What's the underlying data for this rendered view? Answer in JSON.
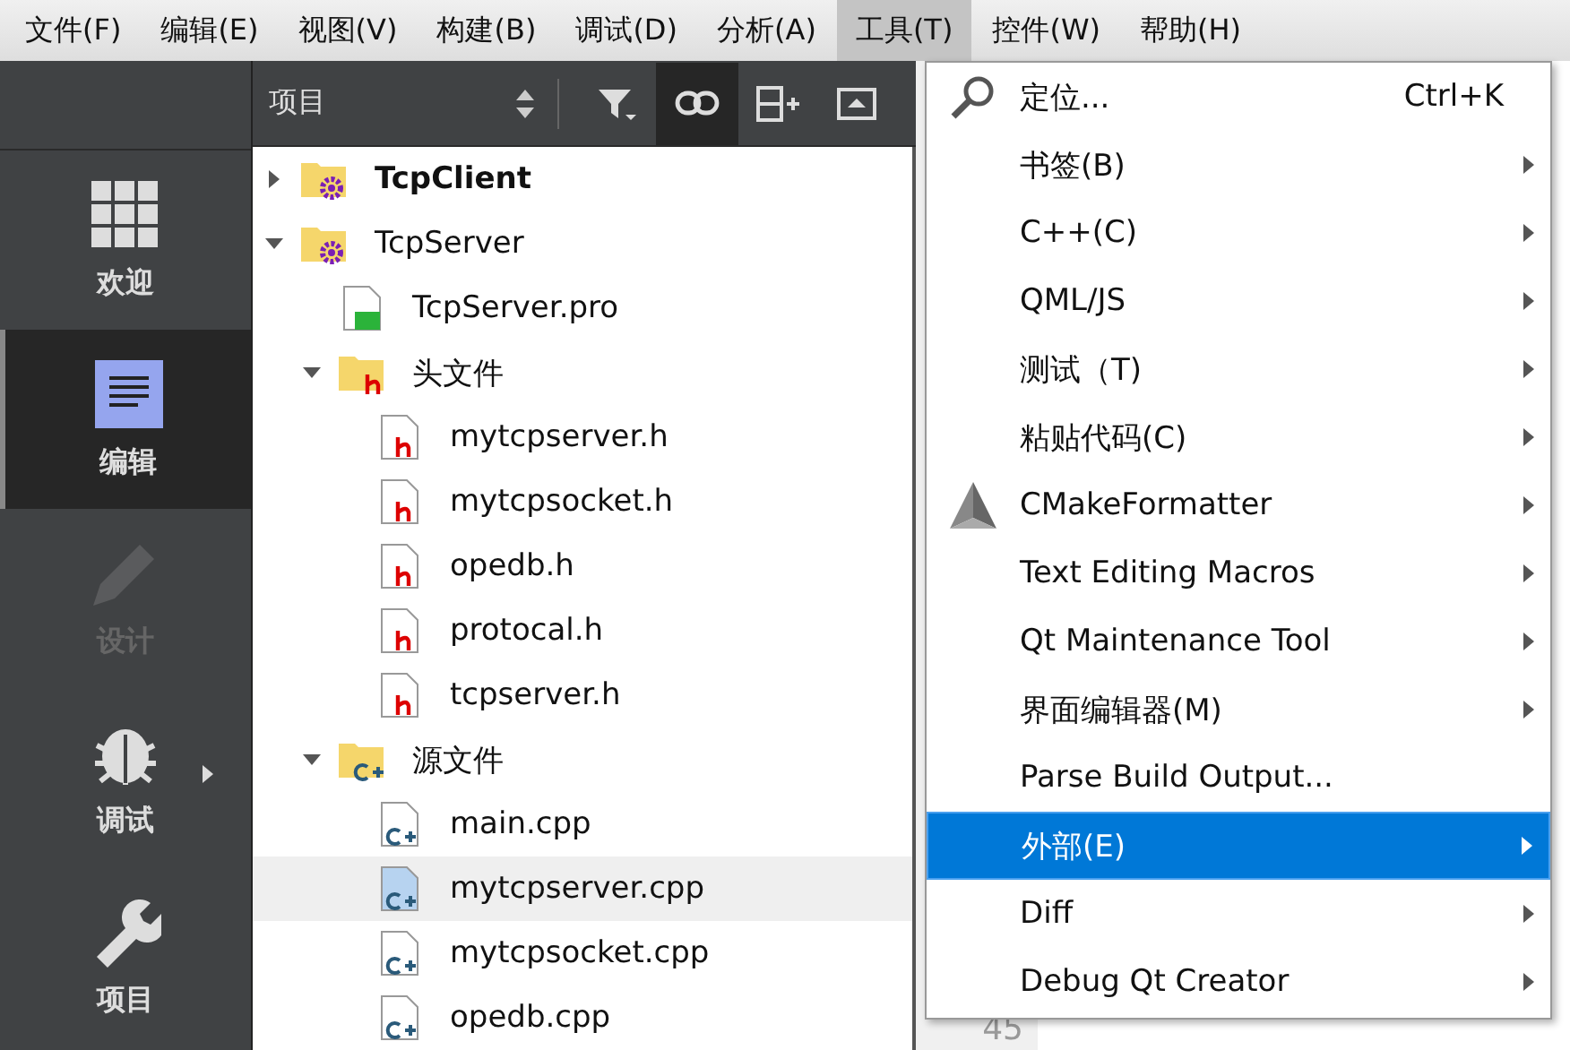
{
  "menubar": [
    {
      "label": "文件(F)",
      "selected": false
    },
    {
      "label": "编辑(E)",
      "selected": false
    },
    {
      "label": "视图(V)",
      "selected": false
    },
    {
      "label": "构建(B)",
      "selected": false
    },
    {
      "label": "调试(D)",
      "selected": false
    },
    {
      "label": "分析(A)",
      "selected": false
    },
    {
      "label": "工具(T)",
      "selected": true
    },
    {
      "label": "控件(W)",
      "selected": false
    },
    {
      "label": "帮助(H)",
      "selected": false
    }
  ],
  "modes": [
    {
      "label": "欢迎",
      "kind": "welcome",
      "selected": false,
      "disabled": false,
      "submenu": false
    },
    {
      "label": "编辑",
      "kind": "edit",
      "selected": true,
      "disabled": false,
      "submenu": false
    },
    {
      "label": "设计",
      "kind": "design",
      "selected": false,
      "disabled": true,
      "submenu": false
    },
    {
      "label": "调试",
      "kind": "debug",
      "selected": false,
      "disabled": false,
      "submenu": true
    },
    {
      "label": "项目",
      "kind": "projects",
      "selected": false,
      "disabled": false,
      "submenu": false
    }
  ],
  "panel": {
    "view": "项目",
    "link_pressed": true
  },
  "tree": [
    {
      "label": "TcpClient",
      "kind": "project",
      "active": true,
      "expanded": false,
      "selected": false
    },
    {
      "label": "TcpServer",
      "kind": "project",
      "active": false,
      "expanded": true,
      "selected": false,
      "children": [
        {
          "label": "TcpServer.pro",
          "kind": "pro",
          "selected": false
        },
        {
          "label": "头文件",
          "kind": "header-folder",
          "expanded": true,
          "selected": false,
          "children": [
            {
              "label": "mytcpserver.h",
              "kind": "header",
              "selected": false
            },
            {
              "label": "mytcpsocket.h",
              "kind": "header",
              "selected": false
            },
            {
              "label": "opedb.h",
              "kind": "header",
              "selected": false
            },
            {
              "label": "protocal.h",
              "kind": "header",
              "selected": false
            },
            {
              "label": "tcpserver.h",
              "kind": "header",
              "selected": false
            }
          ]
        },
        {
          "label": "源文件",
          "kind": "source-folder",
          "expanded": true,
          "selected": false,
          "children": [
            {
              "label": "main.cpp",
              "kind": "source",
              "selected": false
            },
            {
              "label": "mytcpserver.cpp",
              "kind": "source",
              "selected": true
            },
            {
              "label": "mytcpsocket.cpp",
              "kind": "source",
              "selected": false
            },
            {
              "label": "opedb.cpp",
              "kind": "source",
              "selected": false
            }
          ]
        }
      ]
    }
  ],
  "editor": {
    "line_number": "45"
  },
  "menu": [
    {
      "label": "定位...",
      "kind": "search",
      "shortcut": "Ctrl+K",
      "submenu": false,
      "selected": false
    },
    {
      "label": "书签(B)",
      "submenu": true,
      "selected": false
    },
    {
      "label": "C++(C)",
      "submenu": true,
      "selected": false
    },
    {
      "label": "QML/JS",
      "submenu": true,
      "selected": false
    },
    {
      "label": "测试（T)",
      "submenu": true,
      "selected": false
    },
    {
      "label": "粘贴代码(C)",
      "submenu": true,
      "selected": false
    },
    {
      "label": "CMakeFormatter",
      "kind": "cmake",
      "submenu": true,
      "selected": false
    },
    {
      "label": "Text Editing Macros",
      "submenu": true,
      "selected": false
    },
    {
      "label": "Qt Maintenance Tool",
      "submenu": true,
      "selected": false
    },
    {
      "label": "界面编辑器(M)",
      "submenu": true,
      "selected": false
    },
    {
      "label": "Parse Build Output...",
      "submenu": false,
      "selected": false
    },
    {
      "label": "外部(E)",
      "submenu": true,
      "selected": true
    },
    {
      "label": "Diff",
      "submenu": true,
      "selected": false
    },
    {
      "label": "Debug Qt Creator",
      "submenu": true,
      "selected": false
    }
  ]
}
